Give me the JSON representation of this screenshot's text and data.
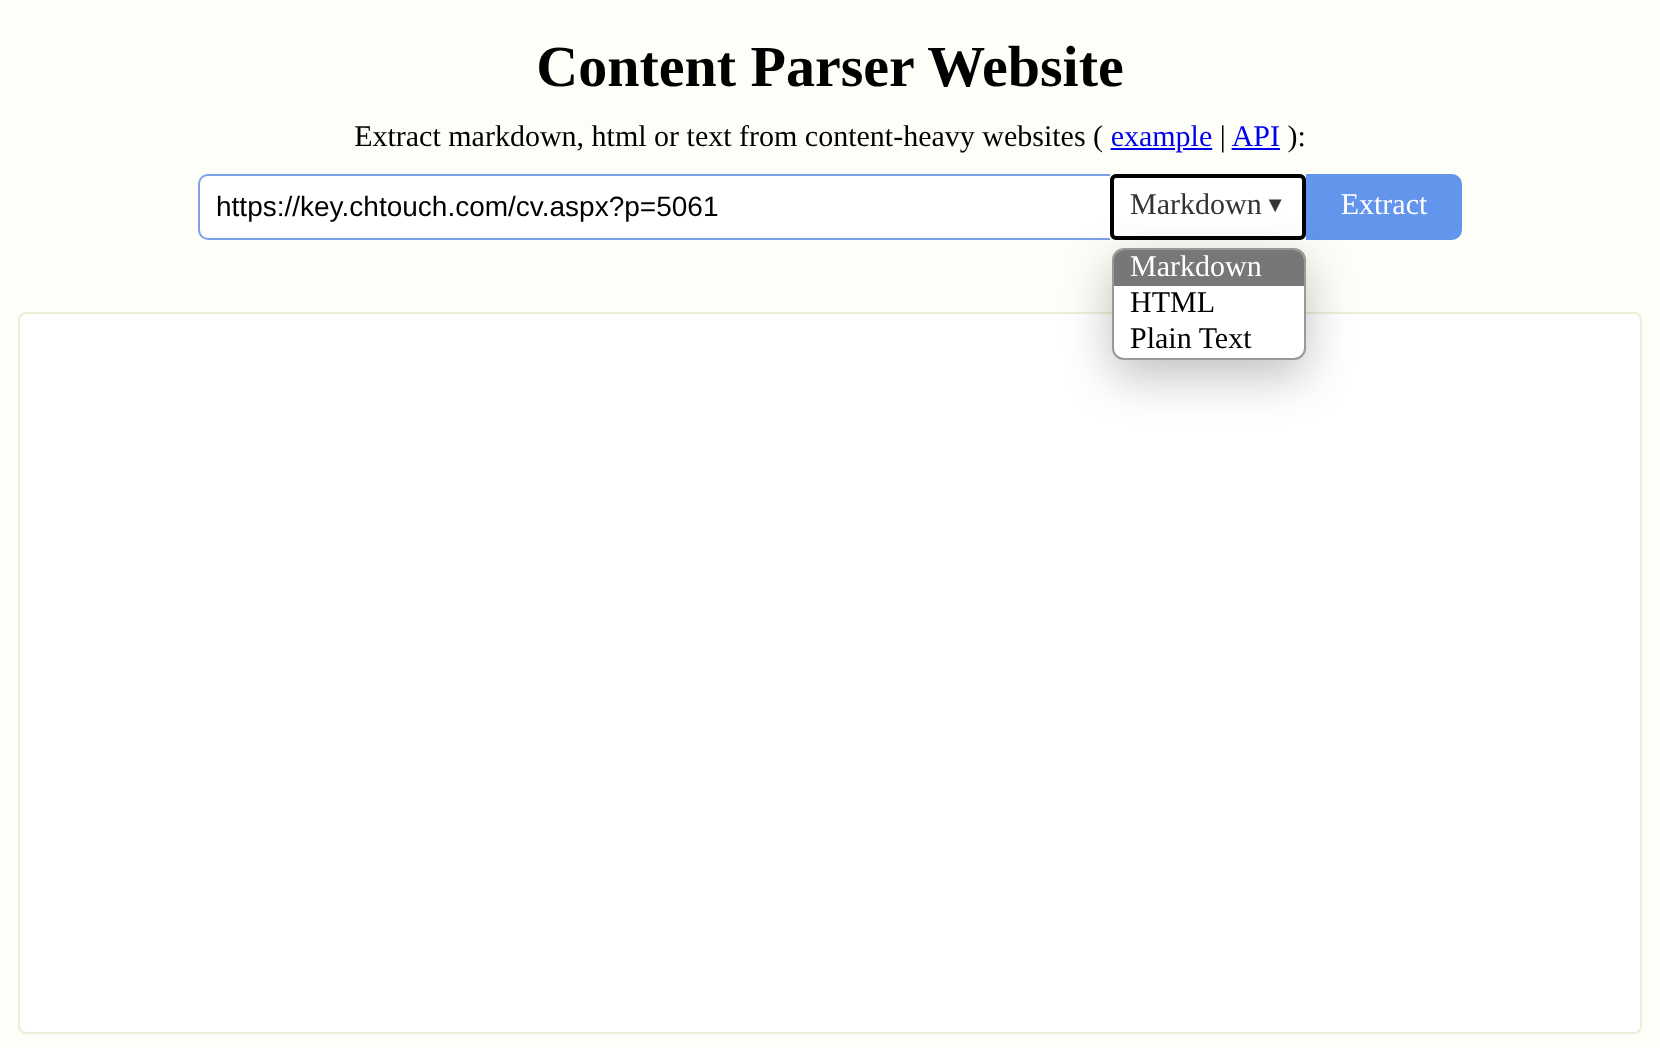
{
  "title": "Content Parser Website",
  "subtitle": {
    "start": "Extract markdown, html or text from content-heavy websites (",
    "links": [
      "example",
      "API"
    ],
    "separator": "|",
    "end": "):"
  },
  "url_field": {
    "value": "https://key.chtouch.com/cv.aspx?p=5061"
  },
  "format_select": {
    "value": "Markdown",
    "arrow": "▼",
    "expanded": true,
    "options": [
      {
        "label": "Markdown",
        "selected": true
      },
      {
        "label": "HTML",
        "selected": false
      },
      {
        "label": "Plain Text",
        "selected": false
      }
    ]
  },
  "extract_button": "Extract"
}
